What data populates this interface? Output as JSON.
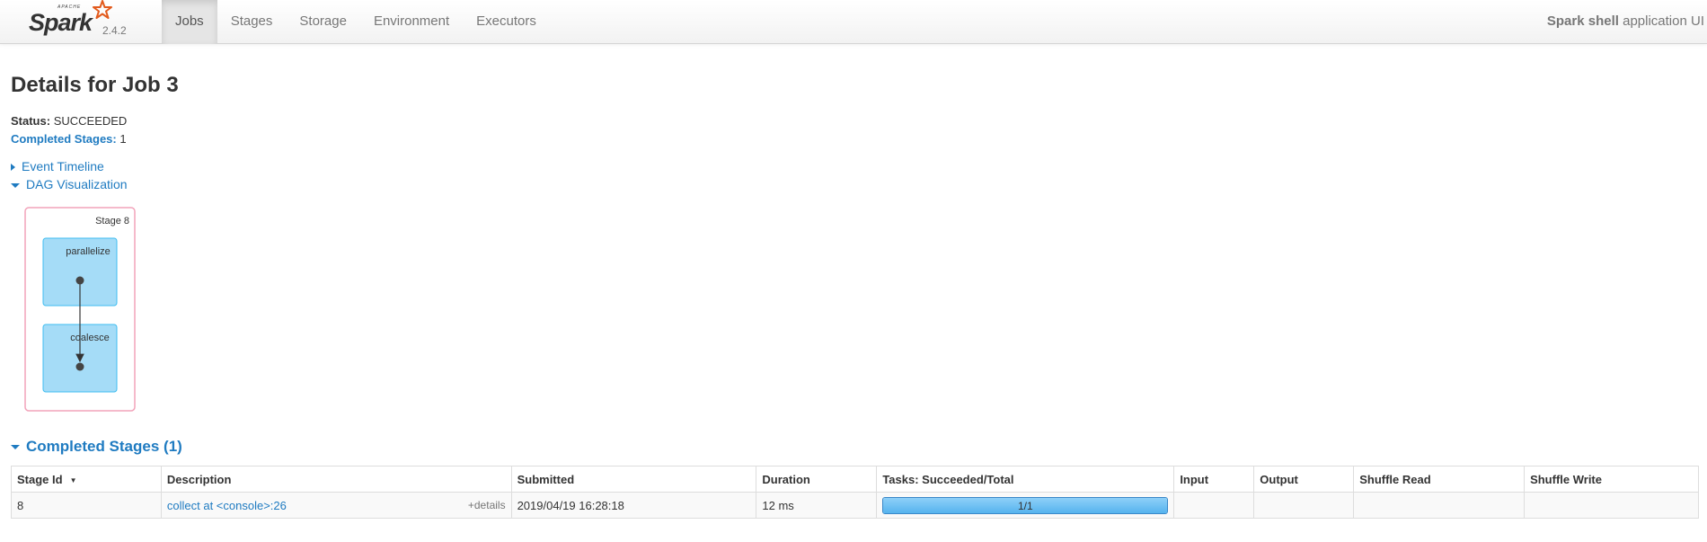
{
  "navbar": {
    "brand_apache": "APACHE",
    "brand_name": "Spark",
    "version": "2.4.2",
    "tabs": [
      {
        "label": "Jobs",
        "active": true
      },
      {
        "label": "Stages",
        "active": false
      },
      {
        "label": "Storage",
        "active": false
      },
      {
        "label": "Environment",
        "active": false
      },
      {
        "label": "Executors",
        "active": false
      }
    ],
    "app_name": "Spark shell",
    "app_suffix": " application UI"
  },
  "page": {
    "title": "Details for Job 3",
    "status_label": "Status:",
    "status_value": "SUCCEEDED",
    "completed_label": "Completed Stages:",
    "completed_value": "1"
  },
  "toggles": {
    "event_timeline": "Event Timeline",
    "dag_visualization": "DAG Visualization"
  },
  "dag": {
    "stage_label": "Stage 8",
    "nodes": [
      "parallelize",
      "coalesce"
    ]
  },
  "completed_section": {
    "title": "Completed Stages (1)",
    "columns": [
      "Stage Id",
      "Description",
      "Submitted",
      "Duration",
      "Tasks: Succeeded/Total",
      "Input",
      "Output",
      "Shuffle Read",
      "Shuffle Write"
    ],
    "sort_indicator": "▼",
    "rows": [
      {
        "stage_id": "8",
        "description": "collect at <console>:26",
        "details": "+details",
        "submitted": "2019/04/19 16:28:18",
        "duration": "12 ms",
        "tasks_label": "1/1",
        "tasks_fraction": 1.0,
        "input": "",
        "output": "",
        "shuffle_read": "",
        "shuffle_write": ""
      }
    ]
  },
  "colors": {
    "link": "#1f7bc1",
    "dag_border": "#f2a3ba",
    "dag_node_fill": "#a5dcf7",
    "dag_node_border": "#3ebdf0",
    "progress_fill": "#55b3ee"
  }
}
